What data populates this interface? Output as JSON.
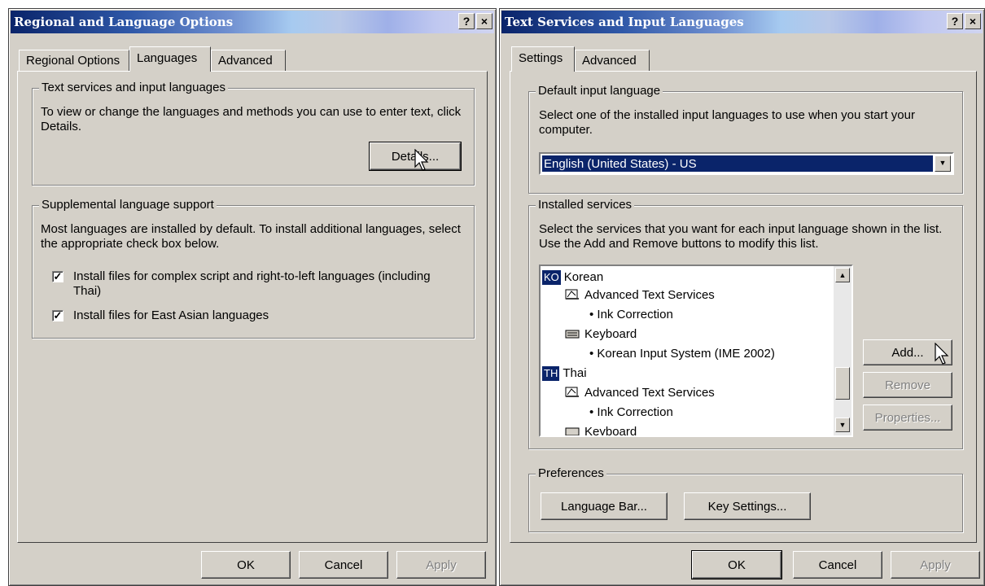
{
  "left_window": {
    "title": "Regional and Language Options",
    "help_btn": "?",
    "close_btn": "×",
    "tabs": [
      "Regional Options",
      "Languages",
      "Advanced"
    ],
    "active_tab": "Languages",
    "text_services": {
      "legend": "Text services and input languages",
      "description": "To view or change the languages and methods you can use to enter text, click Details.",
      "details_button": "Details..."
    },
    "supplemental": {
      "legend": "Supplemental language support",
      "description": "Most languages are installed by default. To install additional languages, select the appropriate check box below.",
      "checkboxes": [
        {
          "label": "Install files for complex script and right-to-left languages (including Thai)",
          "checked": true
        },
        {
          "label": "Install files for East Asian languages",
          "checked": true
        }
      ]
    },
    "buttons": {
      "ok": "OK",
      "cancel": "Cancel",
      "apply": "Apply"
    }
  },
  "right_window": {
    "title": "Text Services and Input Languages",
    "help_btn": "?",
    "close_btn": "×",
    "tabs": [
      "Settings",
      "Advanced"
    ],
    "active_tab": "Settings",
    "default_input": {
      "legend": "Default input language",
      "description": "Select one of the installed input languages to use when you start your computer.",
      "selected": "English (United States) - US"
    },
    "installed_services": {
      "legend": "Installed services",
      "description": "Select the services that you want for each input language shown in the list. Use the Add and Remove buttons to modify this list.",
      "items": [
        {
          "badge": "KO",
          "text": "Korean"
        },
        {
          "text": "Advanced Text Services"
        },
        {
          "text": "• Ink Correction"
        },
        {
          "text": "Keyboard"
        },
        {
          "text": "• Korean Input System (IME 2002)"
        },
        {
          "badge": "TH",
          "text": "Thai"
        },
        {
          "text": "Advanced Text Services"
        },
        {
          "text": "• Ink Correction"
        },
        {
          "text": "Keyboard"
        }
      ],
      "add_button": "Add...",
      "remove_button": "Remove",
      "properties_button": "Properties..."
    },
    "preferences": {
      "legend": "Preferences",
      "language_bar_button": "Language Bar...",
      "key_settings_button": "Key Settings..."
    },
    "buttons": {
      "ok": "OK",
      "cancel": "Cancel",
      "apply": "Apply"
    }
  }
}
